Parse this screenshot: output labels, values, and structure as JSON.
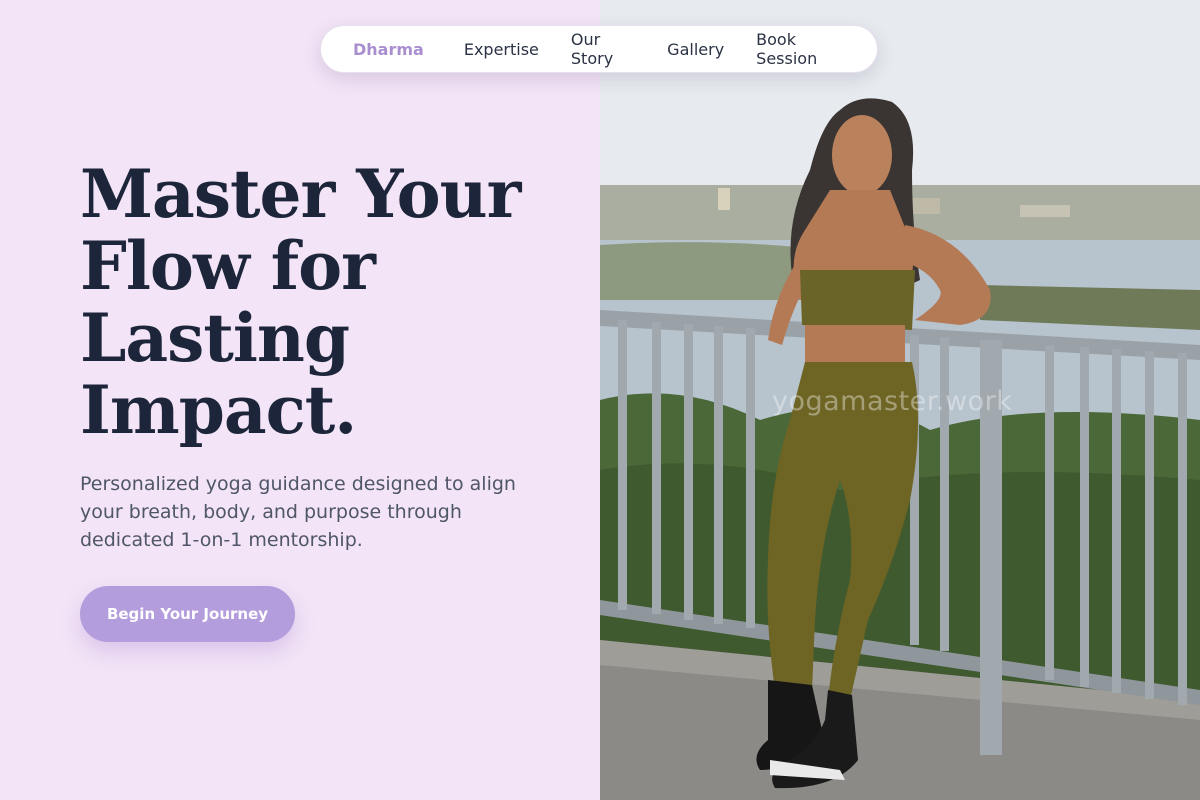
{
  "nav": {
    "brand": "Dharma",
    "links": [
      "Expertise",
      "Our Story",
      "Gallery",
      "Book Session"
    ]
  },
  "hero": {
    "title_lines": [
      "Master Your",
      "Flow for",
      "Lasting",
      "Impact."
    ],
    "subtitle_lines": [
      "Personalized yoga guidance designed to align",
      "your breath, body, and purpose through",
      "dedicated 1-on-1 mentorship."
    ],
    "cta_label": "Begin Your Journey"
  },
  "photo": {
    "watermark": "yogamaster.work",
    "alt": "woman in olive activewear leaning on railing above city lake"
  },
  "colors": {
    "background": "#f3e4f7",
    "brand": "#a98fcf",
    "heading": "#1c2539",
    "cta": "#b39ddc"
  }
}
